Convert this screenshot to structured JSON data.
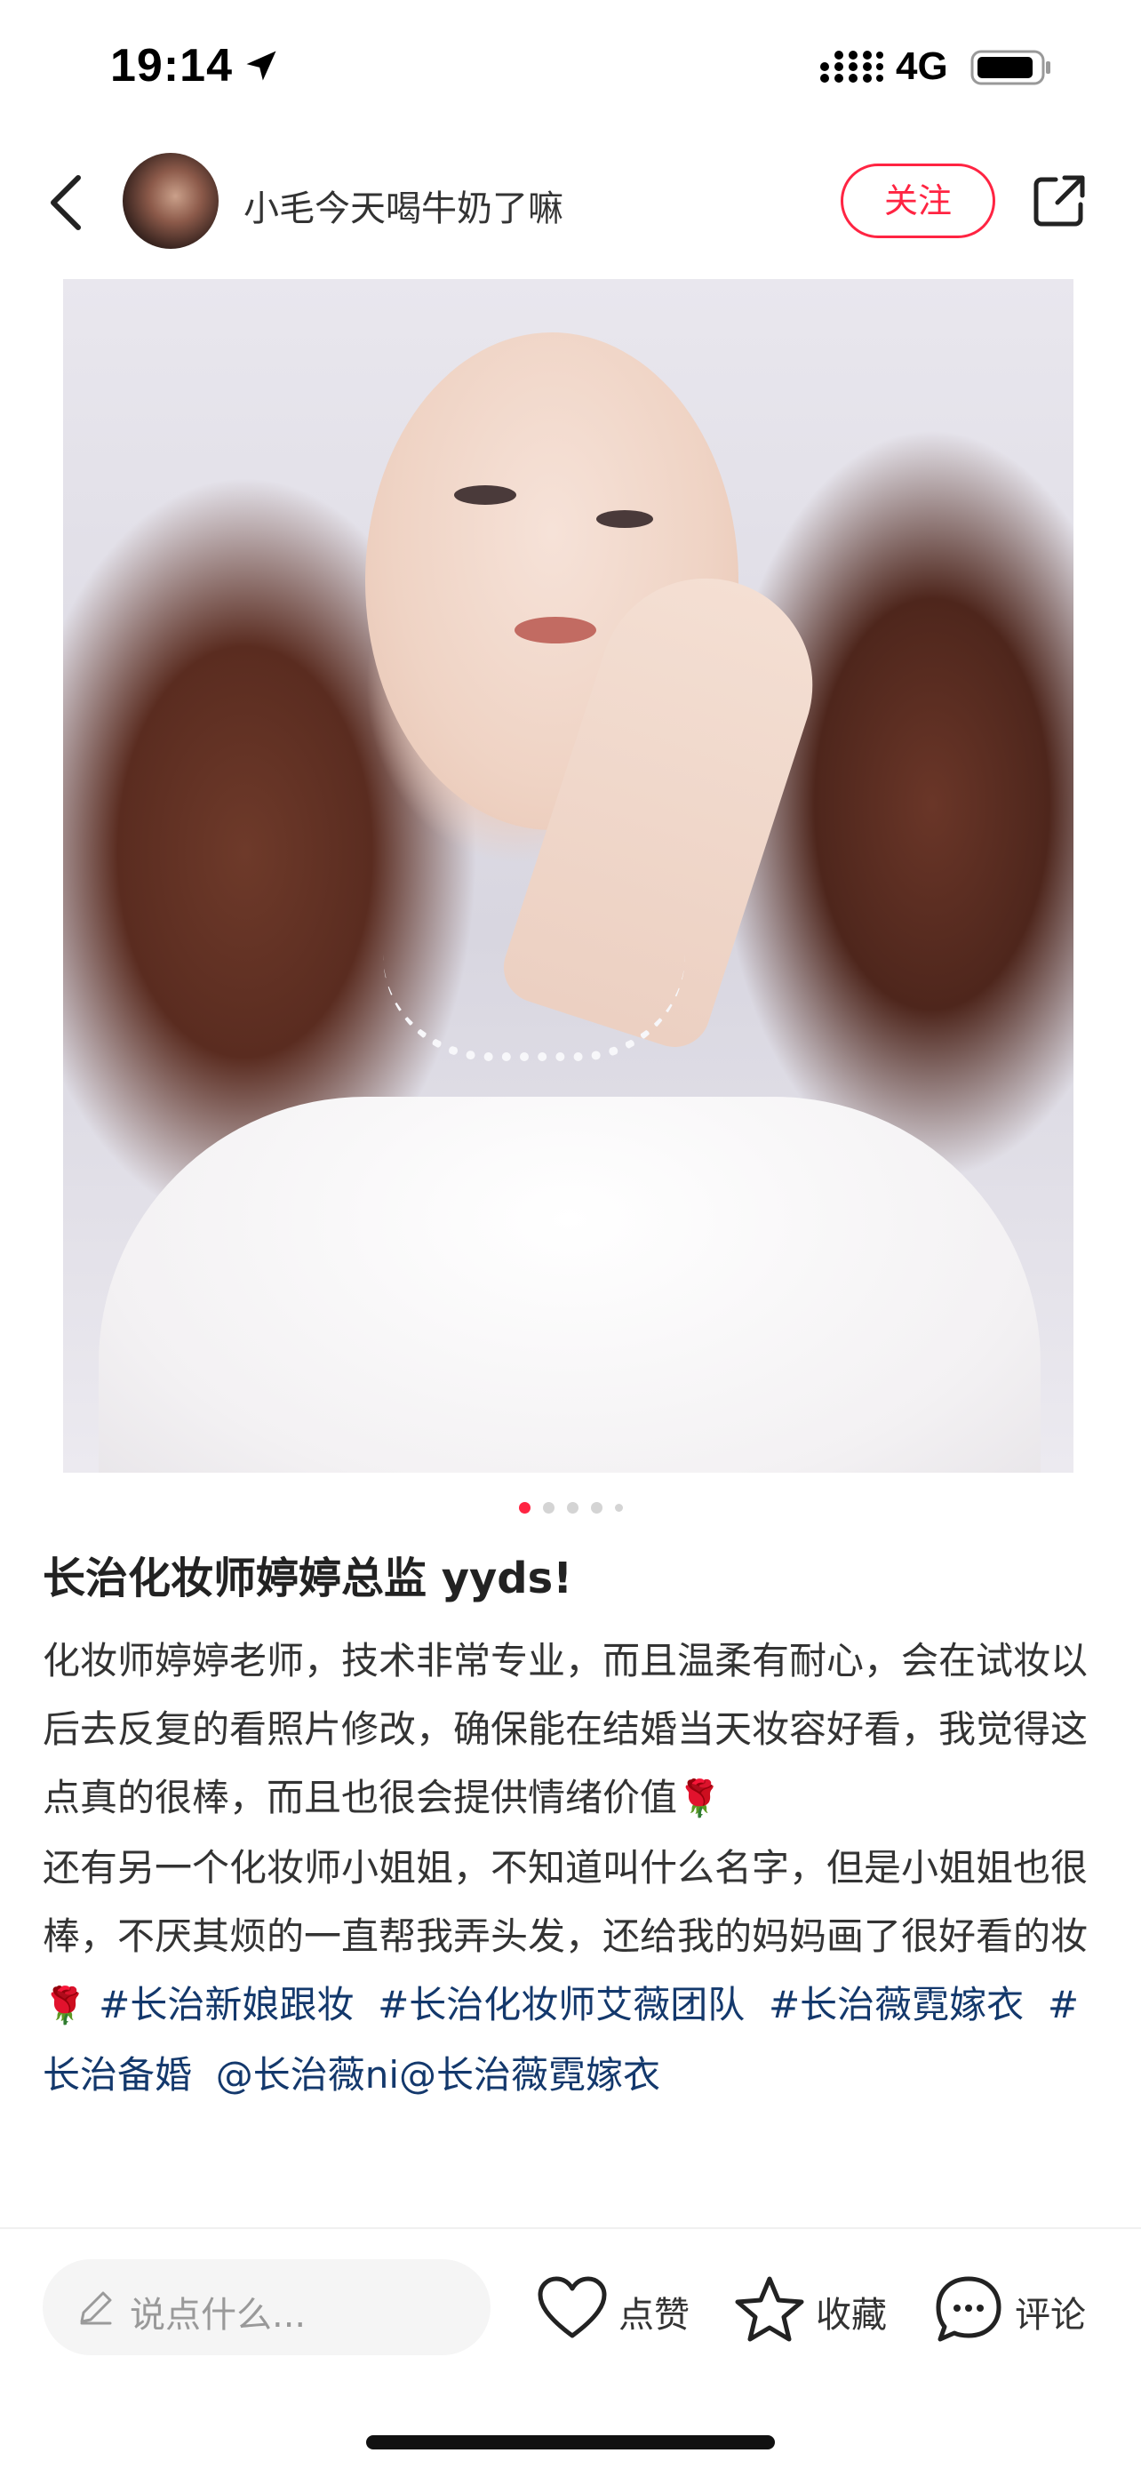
{
  "status_bar": {
    "time": "19:14",
    "network": "4G",
    "icons": [
      "location-arrow-icon",
      "signal-icon",
      "battery-icon"
    ]
  },
  "header": {
    "author_name": "小毛今天喝牛奶了嘛",
    "follow_label": "关注",
    "icons": [
      "back-icon",
      "share-icon"
    ]
  },
  "pager": {
    "total": 5,
    "active_index": 0
  },
  "post": {
    "title": "长治化妆师婷婷总监 yyds!",
    "paragraph1": "化妆师婷婷老师，技术非常专业，而且温柔有耐心，会在试妆以后去反复的看照片修改，确保能在结婚当天妆容好看，我觉得这点真的很棒，而且也很会提供情绪价值",
    "paragraph2": "还有另一个化妆师小姐姐，不知道叫什么名字，但是小姐姐也很棒，不厌其烦的一直帮我弄头发，还给我的妈妈画了很好看的妆",
    "emoji": "🌹",
    "tags": [
      "#长治新娘跟妆",
      "#长治化妆师艾薇团队",
      "#长治薇霓嫁衣",
      "#长治备婚"
    ],
    "mentions": "@长治薇ni@长治薇霓嫁衣"
  },
  "bottom_bar": {
    "comment_placeholder": "说点什么...",
    "like_label": "点赞",
    "collect_label": "收藏",
    "comment_label": "评论"
  },
  "colors": {
    "accent": "#ff2442",
    "tag": "#13386c",
    "text": "#333333"
  }
}
